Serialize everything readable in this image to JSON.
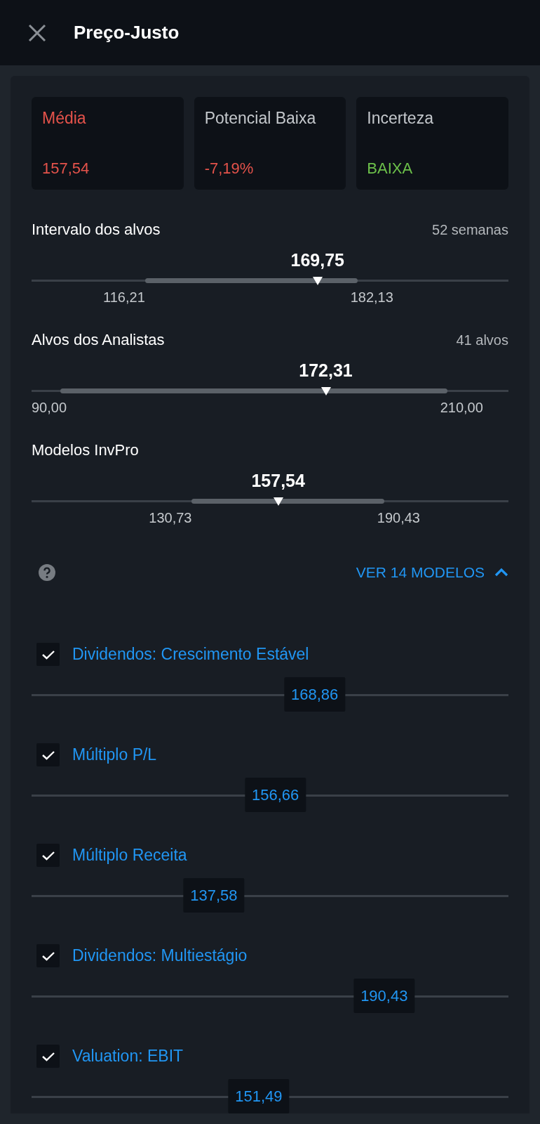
{
  "header": {
    "title": "Preço-Justo"
  },
  "summary_cards": [
    {
      "label": "Média",
      "value": "157,54",
      "color": "#e5534b",
      "kind": "accent"
    },
    {
      "label": "Potencial Baixa",
      "value": "-7,19%",
      "color": "#e5534b",
      "kind": "plain"
    },
    {
      "label": "Incerteza",
      "value": "BAIXA",
      "color": "#6cc04a",
      "kind": "plain"
    }
  ],
  "ranges": [
    {
      "title": "Intervalo dos alvos",
      "note": "52 semanas",
      "value": "169,75",
      "low": "116,21",
      "high": "182,13"
    },
    {
      "title": "Alvos dos Analistas",
      "note": "41 alvos",
      "value": "172,31",
      "low": "90,00",
      "high": "210,00"
    },
    {
      "title": "Modelos InvPro",
      "value": "157,54",
      "low": "130,73",
      "high": "190,43"
    }
  ],
  "models_toggle": {
    "label": "VER 14 MODELOS",
    "expanded": true
  },
  "models": [
    {
      "name": "Dividendos: Crescimento Estável",
      "value": "168,86",
      "checked": true
    },
    {
      "name": "Múltiplo P/L",
      "value": "156,66",
      "checked": true
    },
    {
      "name": "Múltiplo Receita",
      "value": "137,58",
      "checked": true
    },
    {
      "name": "Dividendos: Multiestágio",
      "value": "190,43",
      "checked": true
    },
    {
      "name": "Valuation: EBIT",
      "value": "151,49",
      "checked": true
    }
  ]
}
